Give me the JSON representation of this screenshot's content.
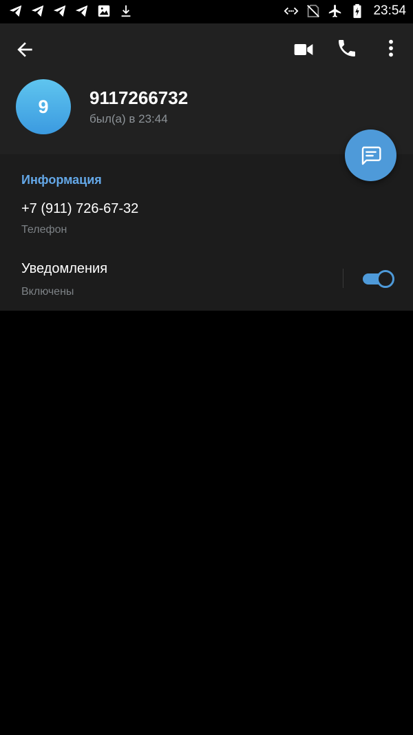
{
  "status_bar": {
    "time": "23:54",
    "left_icons": [
      "telegram-icon",
      "telegram-icon",
      "telegram-icon",
      "telegram-icon",
      "image-icon",
      "download-icon"
    ],
    "right_icons": [
      "data-saver-icon",
      "no-sim-icon",
      "airplane-icon",
      "battery-charging-icon"
    ]
  },
  "toolbar": {
    "back_icon": "arrow-back-icon",
    "video_icon": "video-call-icon",
    "call_icon": "phone-icon",
    "more_icon": "more-vert-icon"
  },
  "profile": {
    "avatar_letter": "9",
    "name": "9117266732",
    "last_seen": "был(а) в 23:44"
  },
  "fab": {
    "icon": "message-icon"
  },
  "info": {
    "section_title": "Информация",
    "phone": "+7 (911) 726-67-32",
    "phone_label": "Телефон",
    "notifications_title": "Уведомления",
    "notifications_status": "Включены",
    "notifications_enabled": true
  },
  "colors": {
    "accent": "#4e9ad9",
    "section_title": "#64a8e8",
    "header_bg": "#212121",
    "info_bg": "#1c1c1c",
    "background": "#000000"
  }
}
